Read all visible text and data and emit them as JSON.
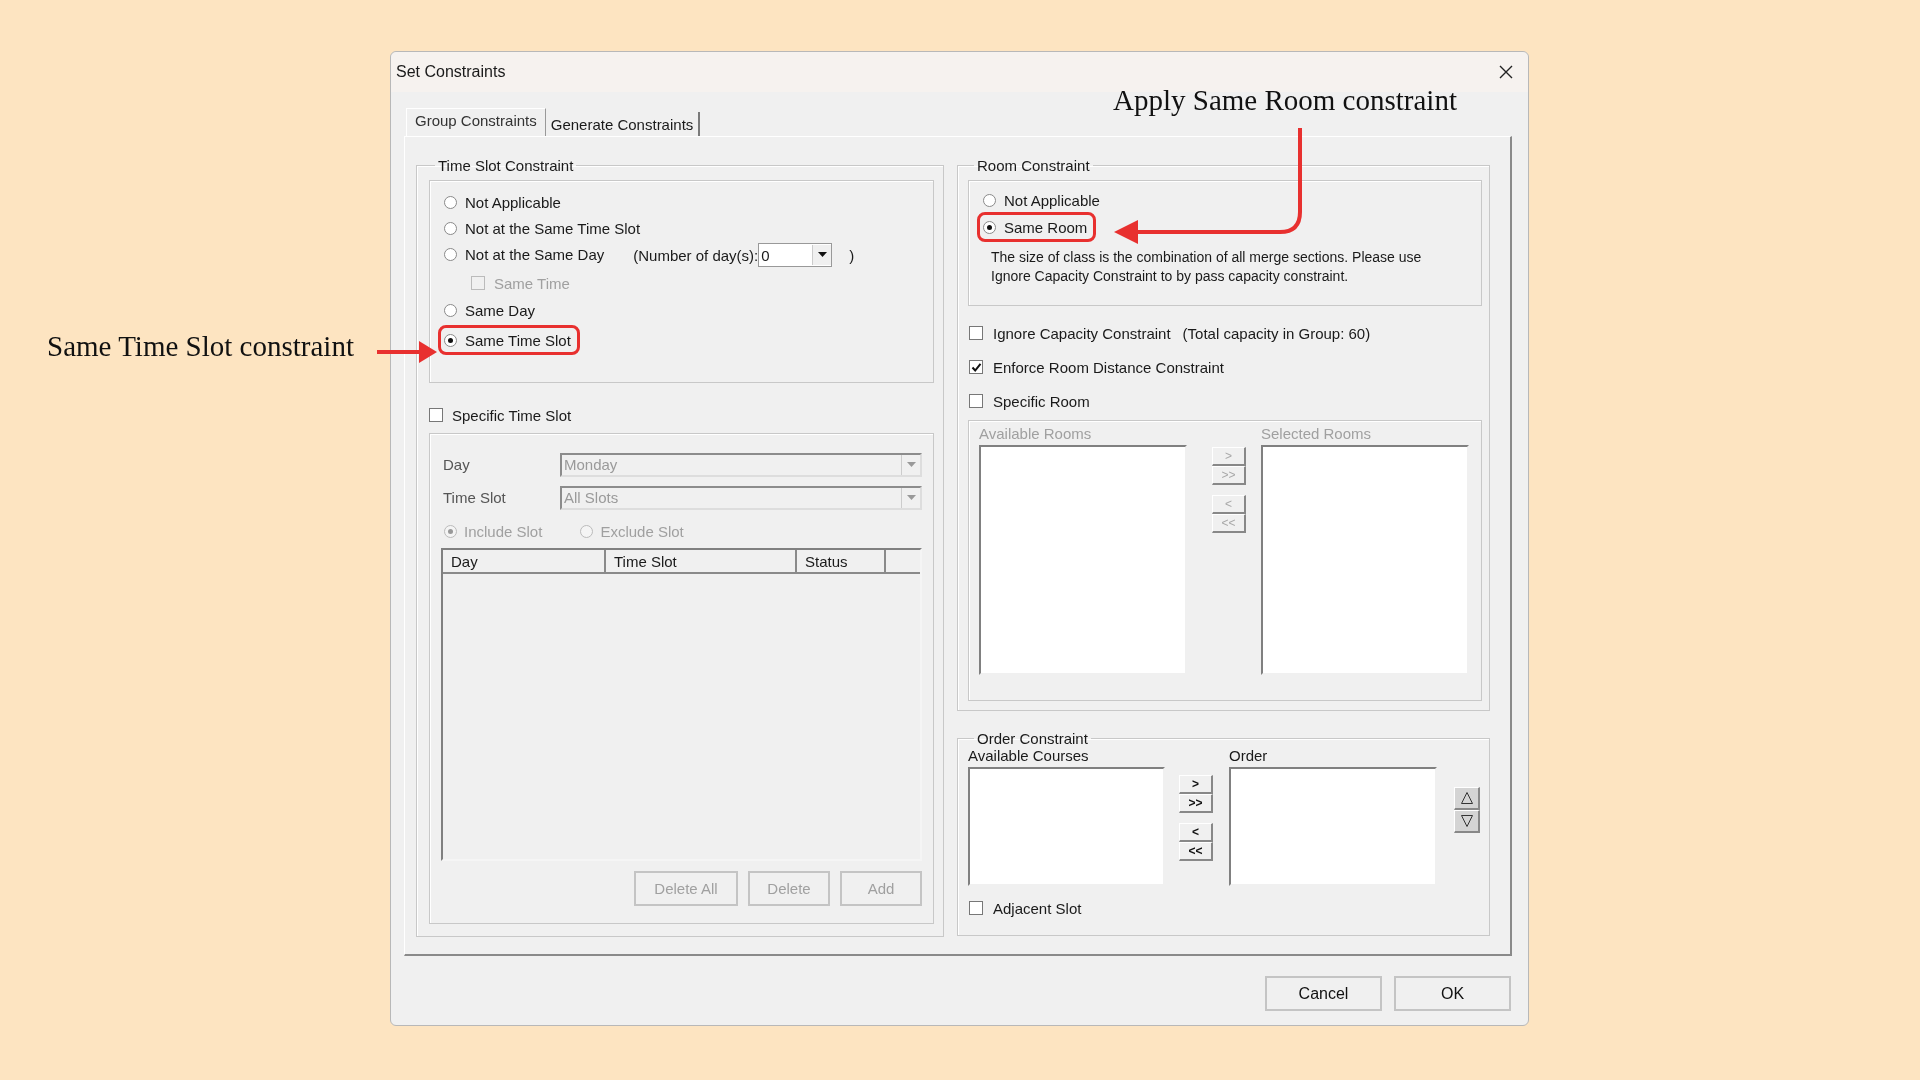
{
  "window": {
    "title": "Set Constraints"
  },
  "tabs": [
    {
      "label": "Group Constraints",
      "selected": true
    },
    {
      "label": "Generate Constraints",
      "selected": false
    }
  ],
  "time_slot_constraint": {
    "title": "Time Slot Constraint",
    "options": [
      {
        "kind": "radio",
        "label": "Not Applicable",
        "selected": false,
        "highlighted": false
      },
      {
        "kind": "radio",
        "label": "Not at the Same Time Slot",
        "selected": false,
        "highlighted": false
      },
      {
        "kind": "radio_days",
        "label": "Not at the Same Day",
        "selected": false,
        "highlighted": false,
        "days_label": "(Number of day(s):",
        "days_value": "0",
        "days_close": ")"
      },
      {
        "kind": "checkbox",
        "label": "Same Time",
        "checked": false,
        "disabled": true
      },
      {
        "kind": "radio",
        "label": "Same Day",
        "selected": false,
        "highlighted": false
      },
      {
        "kind": "radio",
        "label": "Same Time Slot",
        "selected": true,
        "highlighted": true
      }
    ]
  },
  "specific_time_slot": {
    "label": "Specific Time Slot",
    "checked": false,
    "disabled": true,
    "day_label": "Day",
    "day_value": "Monday",
    "slot_label": "Time Slot",
    "slot_value": "All Slots",
    "modes": [
      {
        "label": "Include Slot",
        "selected": true
      },
      {
        "label": "Exclude Slot",
        "selected": false
      }
    ],
    "columns": [
      "Day",
      "Time Slot",
      "Status"
    ],
    "buttons": [
      "Delete All",
      "Delete",
      "Add"
    ]
  },
  "room_constraint": {
    "title": "Room Constraint",
    "options": [
      {
        "label": "Not Applicable",
        "selected": false,
        "highlighted": false
      },
      {
        "label": "Same Room",
        "selected": true,
        "highlighted": true
      }
    ],
    "note": "The size of class is the combination of all merge sections. Please use Ignore Capacity Constraint to by pass capacity constraint.",
    "checks": [
      {
        "label": "Ignore Capacity Constraint",
        "checked": false,
        "extra": "(Total capacity in Group: 60)"
      },
      {
        "label": "Enforce Room Distance Constraint",
        "checked": true
      },
      {
        "label": "Specific Room",
        "checked": false
      }
    ],
    "rooms_disabled": true,
    "available_label": "Available Rooms",
    "selected_label": "Selected Rooms",
    "move_buttons": [
      ">",
      ">>",
      "<",
      "<<"
    ]
  },
  "order_constraint": {
    "title": "Order Constraint",
    "available_label": "Available Courses",
    "order_label": "Order",
    "move_buttons": [
      ">",
      ">>",
      "<",
      "<<"
    ],
    "adjacent": {
      "label": "Adjacent Slot",
      "checked": false
    }
  },
  "buttons": [
    "Cancel",
    "OK"
  ],
  "annotations": [
    {
      "text": "Same Time Slot constraint"
    },
    {
      "text": "Apply Same Room constraint"
    }
  ]
}
